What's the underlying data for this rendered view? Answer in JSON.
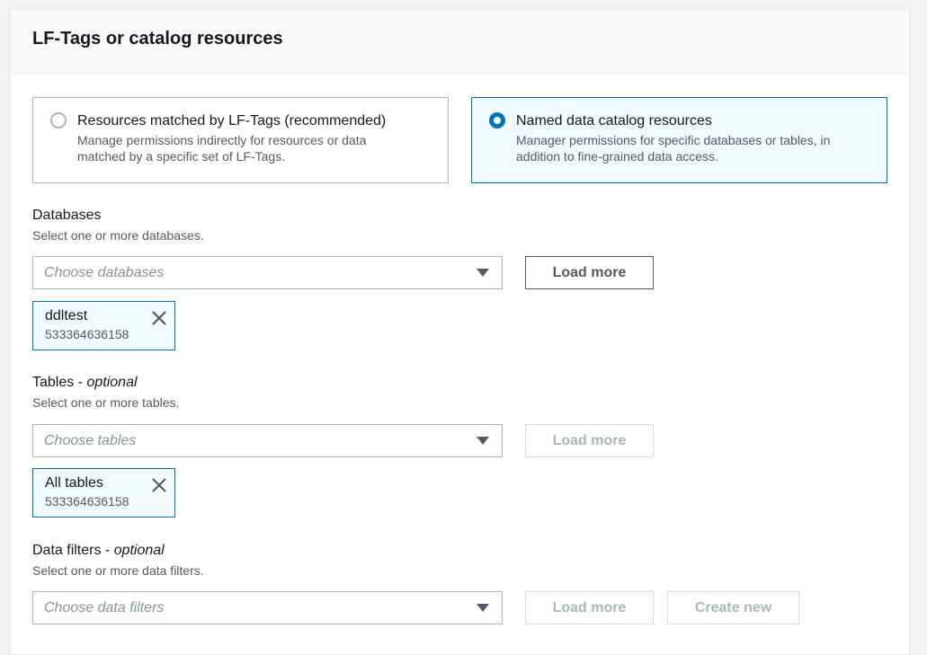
{
  "panel": {
    "title": "LF-Tags or catalog resources"
  },
  "tiles": [
    {
      "title": "Resources matched by LF-Tags (recommended)",
      "desc1": "Manage permissions indirectly for resources or data",
      "desc2": "matched by a specific set of LF-Tags.",
      "selected": false
    },
    {
      "title": "Named data catalog resources",
      "desc1": "Manager permissions for specific databases or tables, in",
      "desc2": "addition to fine-grained data access.",
      "selected": true
    }
  ],
  "databases": {
    "label": "Databases",
    "desc": "Select one or more databases.",
    "placeholder": "Choose databases",
    "load_more": "Load more",
    "token": {
      "name": "ddltest",
      "account": "533364636158"
    }
  },
  "tables": {
    "label": "Tables - ",
    "label_optional": "optional",
    "desc": "Select one or more tables.",
    "placeholder": "Choose tables",
    "load_more": "Load more",
    "token": {
      "name": "All tables",
      "account": "533364636158"
    }
  },
  "data_filters": {
    "label": "Data filters - ",
    "label_optional": "optional",
    "desc": "Select one or more data filters.",
    "placeholder": "Choose data filters",
    "load_more": "Load more",
    "create_new": "Create new"
  }
}
